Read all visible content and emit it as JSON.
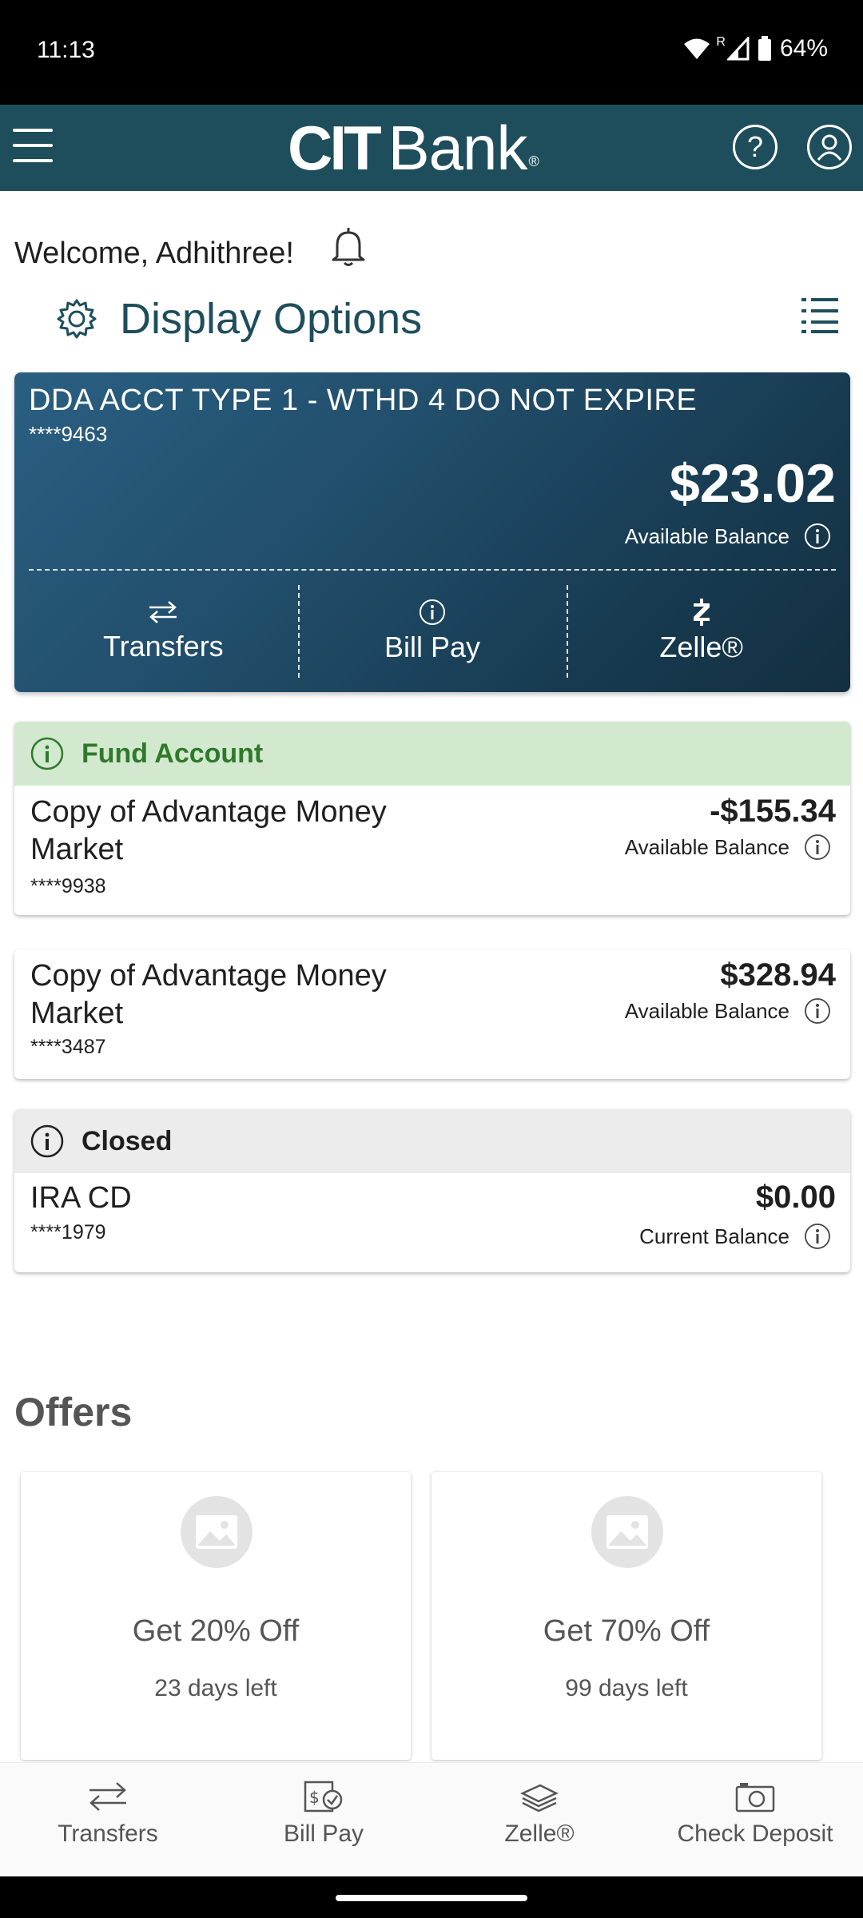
{
  "status_bar": {
    "time": "11:13",
    "roaming": "R",
    "battery": "64%"
  },
  "header": {
    "logo_cit": "CIT",
    "logo_bank": "Bank",
    "logo_reg": "®"
  },
  "welcome": {
    "text": "Welcome, Adhithree!"
  },
  "display_options": {
    "label": "Display Options"
  },
  "featured_account": {
    "name": "DDA ACCT TYPE 1 - WTHD 4 DO NOT EXPIRE",
    "number": "****9463",
    "amount": "$23.02",
    "balance_label": "Available Balance",
    "actions": [
      {
        "label": "Transfers",
        "icon": "transfer-arrows-icon"
      },
      {
        "label": "Bill Pay",
        "icon": "info-icon"
      },
      {
        "label": "Zelle®",
        "icon": "zelle-icon"
      }
    ]
  },
  "accounts": [
    {
      "banner": "Fund Account",
      "name_line1": "Copy of Advantage Money",
      "name_line2": "Market",
      "number": "****9938",
      "amount": "-$155.34",
      "balance_label": "Available Balance"
    },
    {
      "name_line1": "Copy of Advantage Money",
      "name_line2": "Market",
      "number": "****3487",
      "amount": "$328.94",
      "balance_label": "Available Balance"
    },
    {
      "banner": "Closed",
      "name_line1": "IRA CD",
      "number": "****1979",
      "amount": "$0.00",
      "balance_label": "Current Balance"
    }
  ],
  "offers": {
    "title": "Offers",
    "items": [
      {
        "title": "Get 20% Off",
        "days": "23 days left"
      },
      {
        "title": "Get 70% Off",
        "days": "99 days left"
      }
    ]
  },
  "bottom_nav": [
    {
      "label": "Transfers",
      "icon": "transfer-arrows-icon"
    },
    {
      "label": "Bill Pay",
      "icon": "bill-pay-icon"
    },
    {
      "label": "Zelle®",
      "icon": "money-stack-icon"
    },
    {
      "label": "Check Deposit",
      "icon": "camera-icon"
    }
  ],
  "colors": {
    "header": "#1e4e5c",
    "fund_banner": "#d3e9cf",
    "fund_text": "#2f7a2a",
    "closed_banner": "#ececec"
  }
}
